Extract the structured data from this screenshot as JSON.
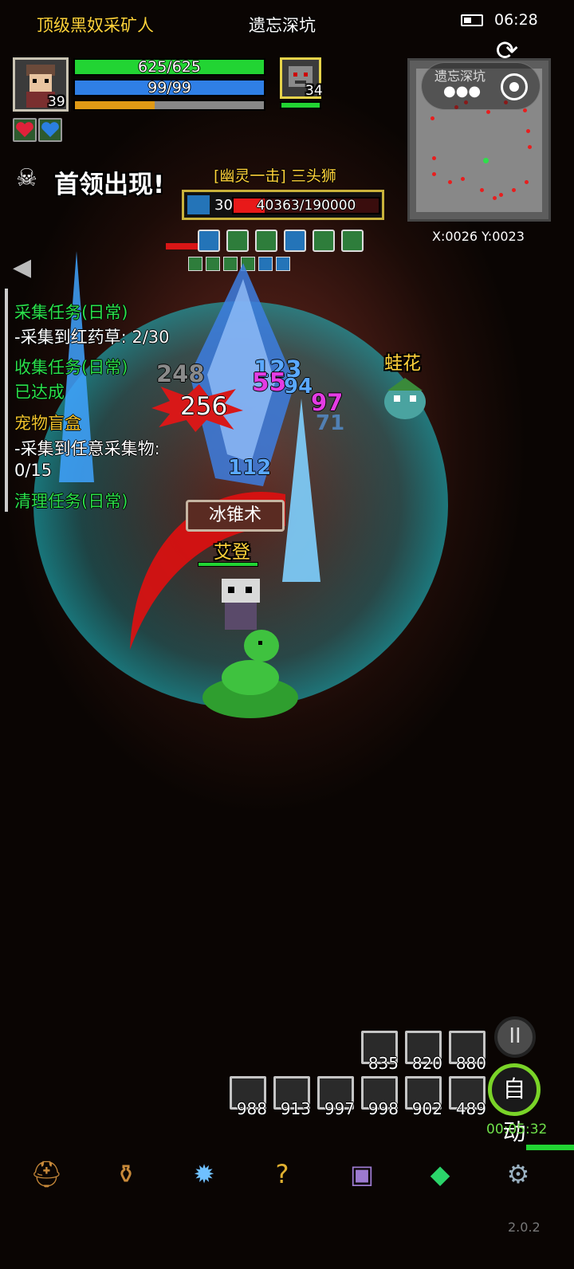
{
  "status_bar": {
    "clock": "06:28"
  },
  "header": {
    "player_name": "顶级黑奴采矿人",
    "map_name": "遗忘深坑"
  },
  "player": {
    "level": "39",
    "hp_text": "625/625",
    "hp_fraction": 1.0,
    "mp_text": "99/99",
    "mp_fraction": 1.0,
    "xp_fraction": 0.42
  },
  "pet": {
    "level": "34",
    "hp_fraction": 1.0
  },
  "minimap": {
    "label": "遗忘深坑",
    "coords": "X:0026  Y:0023"
  },
  "boss": {
    "announcement": "首领出现!",
    "title": "[幽灵一击] 三头狮",
    "level": "30",
    "hp_text": "40363/190000",
    "hp_fraction": 0.2124
  },
  "quests": [
    {
      "text": "采集任务(日常)",
      "color": "green"
    },
    {
      "text": "-采集到红药草: 2/30",
      "color": "white"
    },
    {
      "text": "收集任务(日常)",
      "color": "green"
    },
    {
      "text": "已达成",
      "color": "green"
    },
    {
      "text": "宠物盲盒",
      "color": "yellow"
    },
    {
      "text": "-采集到任意采集物:",
      "color": "white"
    },
    {
      "text": "0/15",
      "color": "white"
    },
    {
      "text": "清理任务(日常)",
      "color": "green"
    }
  ],
  "combat": {
    "skill_name": "冰锥术",
    "ally_name": "艾登",
    "frog_name": "蛙花",
    "damage_numbers": [
      "248",
      "123",
      "55",
      "94",
      "97",
      "71",
      "112"
    ],
    "crit_number": "256"
  },
  "potions_row1": [
    {
      "icon": "red-potion-icon",
      "count": "835"
    },
    {
      "icon": "red-potion-icon",
      "count": "820"
    },
    {
      "icon": "red-potion-icon",
      "count": "880"
    }
  ],
  "potions_row2": [
    {
      "icon": "fish-icon",
      "count": "988"
    },
    {
      "icon": "bottle-icon",
      "count": "913"
    },
    {
      "icon": "red-potion-icon",
      "count": "997"
    },
    {
      "icon": "red-potion-icon",
      "count": "998"
    },
    {
      "icon": "blue-potion-icon",
      "count": "902"
    },
    {
      "icon": "blue-potion-icon",
      "count": "489"
    }
  ],
  "controls": {
    "pause_glyph": "II",
    "auto_label": "自动",
    "timer": "00:05:32"
  },
  "menu": [
    {
      "icon": "helmet-icon"
    },
    {
      "icon": "bag-icon"
    },
    {
      "icon": "crystal-icon"
    },
    {
      "icon": "quest-icon"
    },
    {
      "icon": "monitor-icon"
    },
    {
      "icon": "gem-icon"
    },
    {
      "icon": "gear-icon"
    }
  ],
  "version": "2.0.2",
  "colors": {
    "hp": "#22d433",
    "mp": "#2f7fe6",
    "xp": "#e09a15",
    "boss_hp": "#e81919",
    "name_yellow": "#ffd23a",
    "quest_green": "#2be04a"
  }
}
